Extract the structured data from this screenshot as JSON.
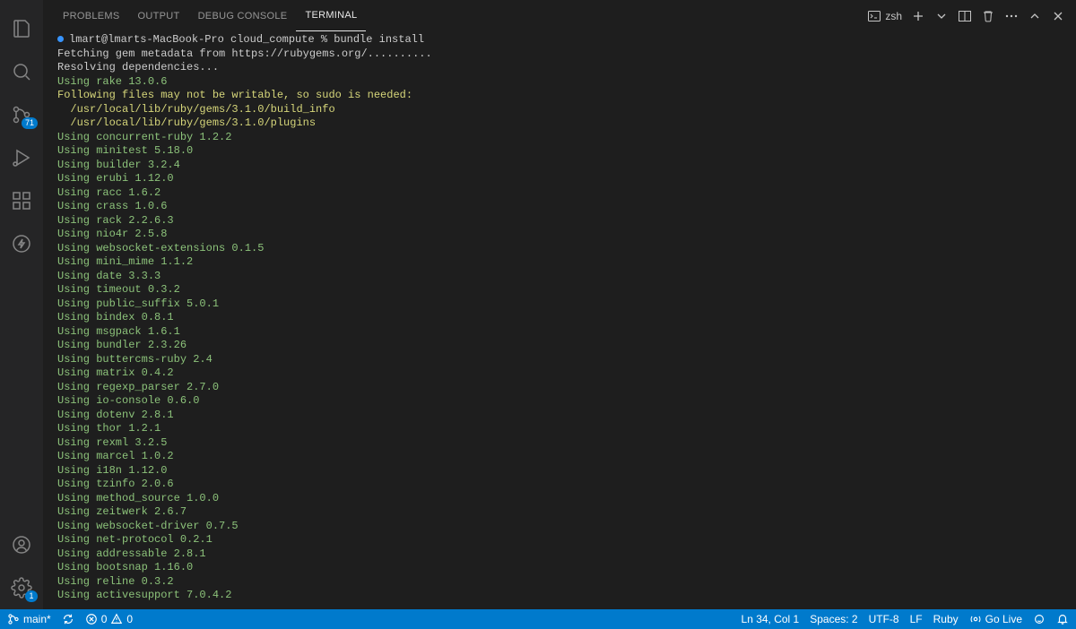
{
  "activity": {
    "scm_badge": "71",
    "settings_badge": "1"
  },
  "panel": {
    "tabs": {
      "problems": "PROBLEMS",
      "output": "OUTPUT",
      "debug": "DEBUG CONSOLE",
      "terminal": "TERMINAL"
    },
    "shell_label": "zsh"
  },
  "terminal": {
    "prompt": "lmart@lmarts-MacBook-Pro cloud_compute % ",
    "command": "bundle install",
    "lines": [
      {
        "t": "Fetching gem metadata from https://rubygems.org/..........",
        "c": "white"
      },
      {
        "t": "Resolving dependencies...",
        "c": "white"
      },
      {
        "t": "Using rake 13.0.6",
        "c": "green"
      },
      {
        "t": "Following files may not be writable, so sudo is needed:",
        "c": "yellow"
      },
      {
        "t": "  /usr/local/lib/ruby/gems/3.1.0/build_info",
        "c": "yellow"
      },
      {
        "t": "  /usr/local/lib/ruby/gems/3.1.0/plugins",
        "c": "yellow"
      },
      {
        "t": "Using concurrent-ruby 1.2.2",
        "c": "green"
      },
      {
        "t": "Using minitest 5.18.0",
        "c": "green"
      },
      {
        "t": "Using builder 3.2.4",
        "c": "green"
      },
      {
        "t": "Using erubi 1.12.0",
        "c": "green"
      },
      {
        "t": "Using racc 1.6.2",
        "c": "green"
      },
      {
        "t": "Using crass 1.0.6",
        "c": "green"
      },
      {
        "t": "Using rack 2.2.6.3",
        "c": "green"
      },
      {
        "t": "Using nio4r 2.5.8",
        "c": "green"
      },
      {
        "t": "Using websocket-extensions 0.1.5",
        "c": "green"
      },
      {
        "t": "Using mini_mime 1.1.2",
        "c": "green"
      },
      {
        "t": "Using date 3.3.3",
        "c": "green"
      },
      {
        "t": "Using timeout 0.3.2",
        "c": "green"
      },
      {
        "t": "Using public_suffix 5.0.1",
        "c": "green"
      },
      {
        "t": "Using bindex 0.8.1",
        "c": "green"
      },
      {
        "t": "Using msgpack 1.6.1",
        "c": "green"
      },
      {
        "t": "Using bundler 2.3.26",
        "c": "green"
      },
      {
        "t": "Using buttercms-ruby 2.4",
        "c": "green"
      },
      {
        "t": "Using matrix 0.4.2",
        "c": "green"
      },
      {
        "t": "Using regexp_parser 2.7.0",
        "c": "green"
      },
      {
        "t": "Using io-console 0.6.0",
        "c": "green"
      },
      {
        "t": "Using dotenv 2.8.1",
        "c": "green"
      },
      {
        "t": "Using thor 1.2.1",
        "c": "green"
      },
      {
        "t": "Using rexml 3.2.5",
        "c": "green"
      },
      {
        "t": "Using marcel 1.0.2",
        "c": "green"
      },
      {
        "t": "Using i18n 1.12.0",
        "c": "green"
      },
      {
        "t": "Using tzinfo 2.0.6",
        "c": "green"
      },
      {
        "t": "Using method_source 1.0.0",
        "c": "green"
      },
      {
        "t": "Using zeitwerk 2.6.7",
        "c": "green"
      },
      {
        "t": "Using websocket-driver 0.7.5",
        "c": "green"
      },
      {
        "t": "Using net-protocol 0.2.1",
        "c": "green"
      },
      {
        "t": "Using addressable 2.8.1",
        "c": "green"
      },
      {
        "t": "Using bootsnap 1.16.0",
        "c": "green"
      },
      {
        "t": "Using reline 0.3.2",
        "c": "green"
      },
      {
        "t": "Using activesupport 7.0.4.2",
        "c": "green"
      }
    ]
  },
  "status": {
    "branch": "main*",
    "errors": "0",
    "warnings": "0",
    "ln_col": "Ln 34, Col 1",
    "spaces": "Spaces: 2",
    "encoding": "UTF-8",
    "eol": "LF",
    "lang": "Ruby",
    "golive": "Go Live"
  }
}
